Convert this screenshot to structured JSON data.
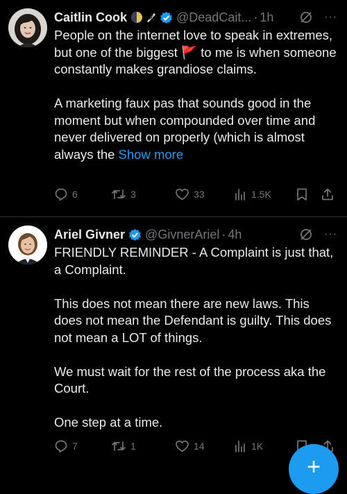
{
  "tweets": [
    {
      "author": "Caitlin Cook",
      "handle": "@DeadCait...",
      "dot": "·",
      "time": "1h",
      "paragraphs": [
        "People on the internet love to speak in extremes, but one of the biggest 🚩 to me is when someone constantly makes grandiose claims.",
        "A marketing faux pas that sounds good in the moment but when compounded over time and never delivered on properly (which is almost always the"
      ],
      "show_more": "Show more",
      "replies": "6",
      "reposts": "3",
      "likes": "33",
      "views": "1.5K"
    },
    {
      "author": "Ariel Givner",
      "handle": "@GivnerAriel",
      "dot": "·",
      "time": "4h",
      "paragraphs": [
        "FRIENDLY REMINDER - A Complaint is just that, a Complaint.",
        "This does not mean there are new laws. This does not mean the Defendant is guilty. This does not mean a LOT of things.",
        "We must wait for the rest of the process aka the Court.",
        "One step at a time."
      ],
      "replies": "7",
      "reposts": "1",
      "likes": "14",
      "views": "1K"
    }
  ],
  "fab_label": "+",
  "more_label": "···",
  "colors": {
    "accent": "#1d9bf0",
    "muted": "#71767b",
    "text": "#e7e9ea",
    "divider": "#2f3336"
  },
  "icons": [
    "verified-icon",
    "moon-icon",
    "feather-icon",
    "grok-icon",
    "more-icon",
    "reply-icon",
    "repost-icon",
    "like-icon",
    "views-icon",
    "bookmark-icon",
    "share-icon"
  ]
}
